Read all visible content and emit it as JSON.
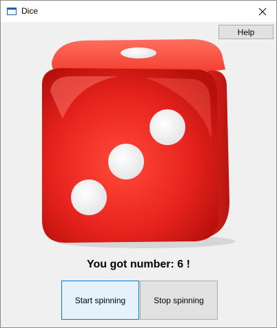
{
  "window": {
    "title": "Dice",
    "close_glyph": "close-icon"
  },
  "toolbar": {
    "help_label": "Help"
  },
  "dice": {
    "icon": "dice-image",
    "face_color": "#e8231e",
    "pip_color": "#ffffff"
  },
  "result": {
    "text": "You got number: 6 !"
  },
  "actions": {
    "start_label": "Start spinning",
    "stop_label": "Stop spinning"
  }
}
